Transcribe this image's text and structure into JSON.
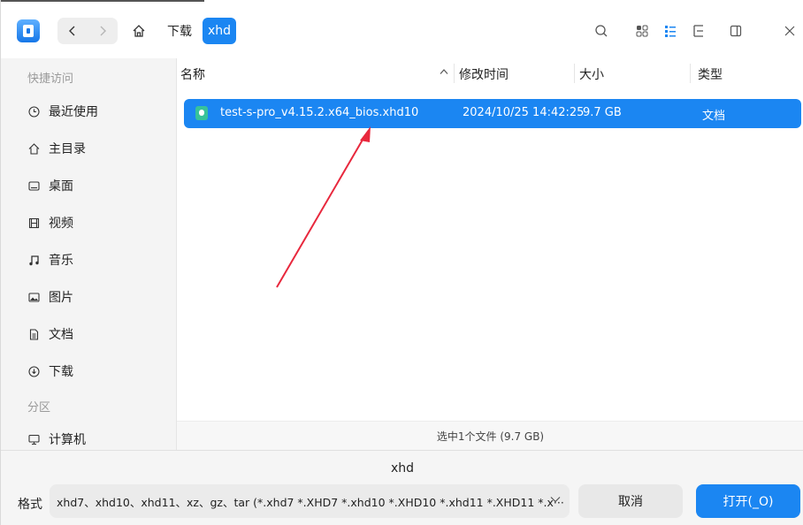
{
  "toolbar": {
    "back_icon": "chevron-left",
    "forward_icon": "chevron-right",
    "home_icon": "home",
    "breadcrumbs": [
      "下载",
      "xhd"
    ],
    "search_icon": "search",
    "icon_view_icon": "grid-view",
    "list_view_icon": "list-view",
    "tree_view_icon": "tree-view",
    "detail_panel_icon": "panel",
    "close_icon": "close"
  },
  "sidebar": {
    "quick_access_label": "快捷访问",
    "items": [
      {
        "label": "最近使用",
        "icon": "clock"
      },
      {
        "label": "主目录",
        "icon": "home"
      },
      {
        "label": "桌面",
        "icon": "desktop"
      },
      {
        "label": "视频",
        "icon": "video"
      },
      {
        "label": "音乐",
        "icon": "music"
      },
      {
        "label": "图片",
        "icon": "image"
      },
      {
        "label": "文档",
        "icon": "document"
      },
      {
        "label": "下载",
        "icon": "download"
      }
    ],
    "partition_label": "分区",
    "computer_label": "计算机"
  },
  "file_list": {
    "columns": {
      "name": "名称",
      "modified": "修改时间",
      "size": "大小",
      "type": "类型"
    },
    "sort_indicator": "^",
    "rows": [
      {
        "name": "test-s-pro_v4.15.2.x64_bios.xhd10",
        "modified": "2024/10/25 14:42:25",
        "size": "9.7 GB",
        "type": "文档",
        "selected": true
      }
    ],
    "status": "选中1个文件 (9.7 GB)"
  },
  "bottom": {
    "filename": "xhd",
    "format_label": "格式",
    "format_value": "xhd7、xhd10、xhd11、xz、gz、tar (*.xhd7 *.XHD7 *.xhd10 *.XHD10 *.xhd11 *.XHD11 *.x··· ",
    "cancel_label": "取消",
    "open_label": "打开(_O)"
  },
  "colors": {
    "accent": "#1b86f2",
    "annotation": "#e8283d"
  }
}
